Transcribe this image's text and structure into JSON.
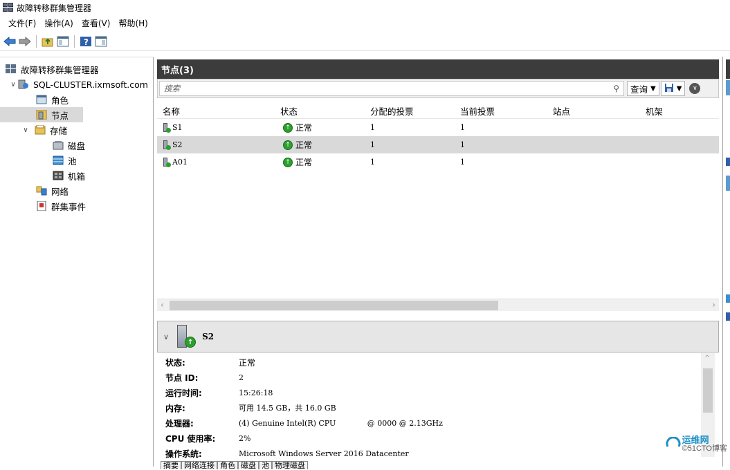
{
  "window": {
    "title": "故障转移群集管理器"
  },
  "menu": [
    "文件(F)",
    "操作(A)",
    "查看(V)",
    "帮助(H)"
  ],
  "tree": {
    "root": "故障转移群集管理器",
    "cluster": "SQL-CLUSTER.ixmsoft.com",
    "items": {
      "roles": "角色",
      "nodes": "节点",
      "storage": "存储",
      "disks": "磁盘",
      "pools": "池",
      "enclosures": "机箱",
      "networks": "网络",
      "events": "群集事件"
    }
  },
  "center": {
    "title": "节点(3)",
    "search_placeholder": "搜索",
    "query_label": "查询",
    "columns": [
      "名称",
      "状态",
      "分配的投票",
      "当前投票",
      "站点",
      "机架"
    ],
    "rows": [
      {
        "name": "S1",
        "status": "正常",
        "assigned": "1",
        "current": "1"
      },
      {
        "name": "S2",
        "status": "正常",
        "assigned": "1",
        "current": "1"
      },
      {
        "name": "A01",
        "status": "正常",
        "assigned": "1",
        "current": "1"
      }
    ],
    "selected_row": "S2"
  },
  "details": {
    "title": "S2",
    "fields": [
      {
        "label": "状态:",
        "value": "正常"
      },
      {
        "label": "节点 ID:",
        "value": "2"
      },
      {
        "label": "运行时间:",
        "value": "15:26:18"
      },
      {
        "label": "内存:",
        "value": "可用 14.5 GB，共 16.0 GB"
      },
      {
        "label": "处理器:",
        "value": "(4) Genuine Intel(R) CPU             @ 0000 @ 2.13GHz"
      },
      {
        "label": "CPU 使用率:",
        "value": "2%"
      },
      {
        "label": "操作系统:",
        "value": "Microsoft Windows Server 2016 Datacenter"
      }
    ],
    "tabs": [
      "摘要",
      "网络连接",
      "角色",
      "磁盘",
      "池",
      "物理磁盘"
    ]
  },
  "watermark": {
    "text": "运维网",
    "sub": "©51CTO博客"
  },
  "icons": [
    "back-arrow-icon",
    "forward-arrow-icon",
    "folder-up-icon",
    "console-tree-icon",
    "help-icon",
    "action-pane-icon"
  ],
  "colors": {
    "header_bg": "#3c3c3c",
    "selection": "#d9d9d9",
    "status_green": "#2ca02c"
  }
}
